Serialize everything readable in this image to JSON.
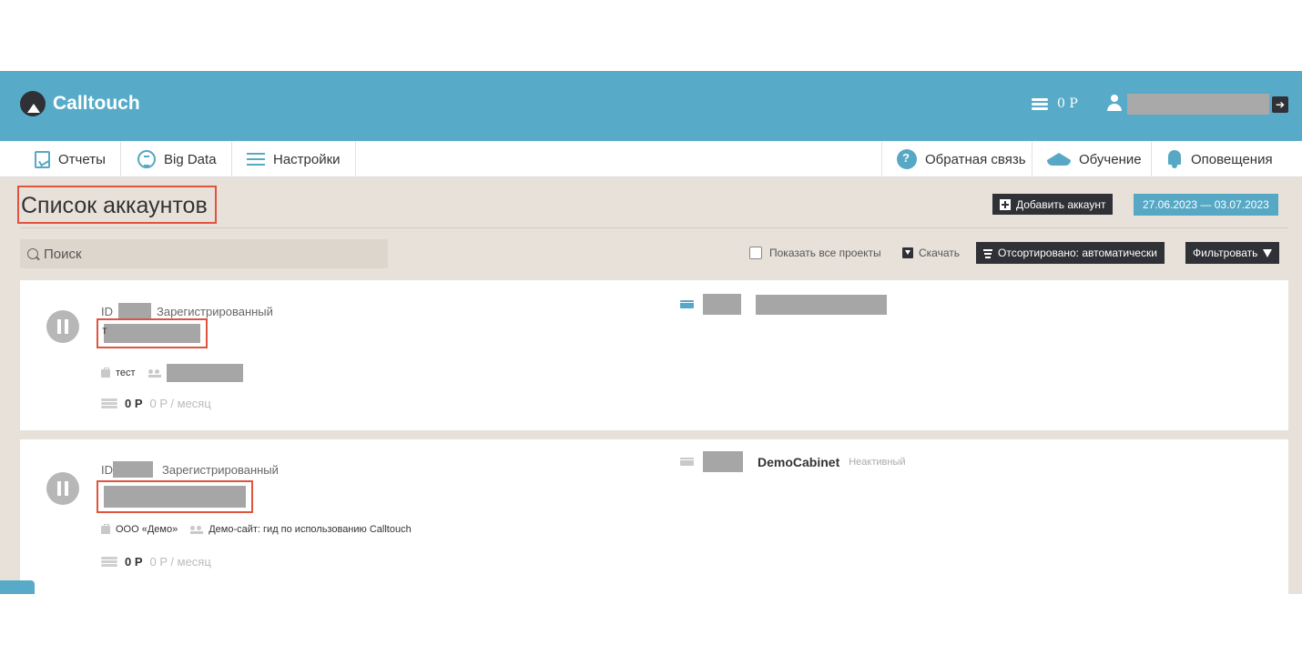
{
  "colors": {
    "brand": "#57abc9",
    "highlight": "#e0533f",
    "dark_button": "#2f3136",
    "page_bg": "#e7e1d9"
  },
  "header": {
    "logo_text": "Calltouch",
    "balance": "0 P",
    "icons": [
      "logo-icon",
      "coins-icon",
      "user-icon",
      "logout-icon"
    ]
  },
  "nav": {
    "left": [
      {
        "label": "Отчеты",
        "icon": "report-icon"
      },
      {
        "label": "Big Data",
        "icon": "bigdata-icon"
      },
      {
        "label": "Настройки",
        "icon": "settings-icon"
      }
    ],
    "right": [
      {
        "label": "Обратная связь",
        "icon": "feedback-icon"
      },
      {
        "label": "Обучение",
        "icon": "education-icon"
      },
      {
        "label": "Оповещения",
        "icon": "bell-icon"
      }
    ]
  },
  "page": {
    "title": "Список аккаунтов",
    "add_account_label": "Добавить аккаунт",
    "date_range": "27.06.2023 — 03.07.2023"
  },
  "toolbar": {
    "search_placeholder": "Поиск",
    "show_all_label": "Показать все проекты",
    "show_all_checked": false,
    "download_label": "Скачать",
    "sort_label": "Отсортировано: автоматически",
    "filter_label": "Фильтровать"
  },
  "accounts": [
    {
      "id_label": "ID",
      "status": "Зарегистрированный",
      "name_prefix": "т",
      "company": "тест",
      "balance": "0 P",
      "monthly": "0 P / месяц",
      "site_icon_color": "#56a8c5"
    },
    {
      "id_label": "ID",
      "status": "Зарегистрированный",
      "company": "ООО «Демо»",
      "site": "Демо-сайт: гид по использованию Calltouch",
      "balance": "0 P",
      "monthly": "0 P / месяц",
      "cabinet_name": "DemoCabinet",
      "cabinet_status": "Неактивный",
      "site_icon_color": "#c9c9c9"
    }
  ]
}
